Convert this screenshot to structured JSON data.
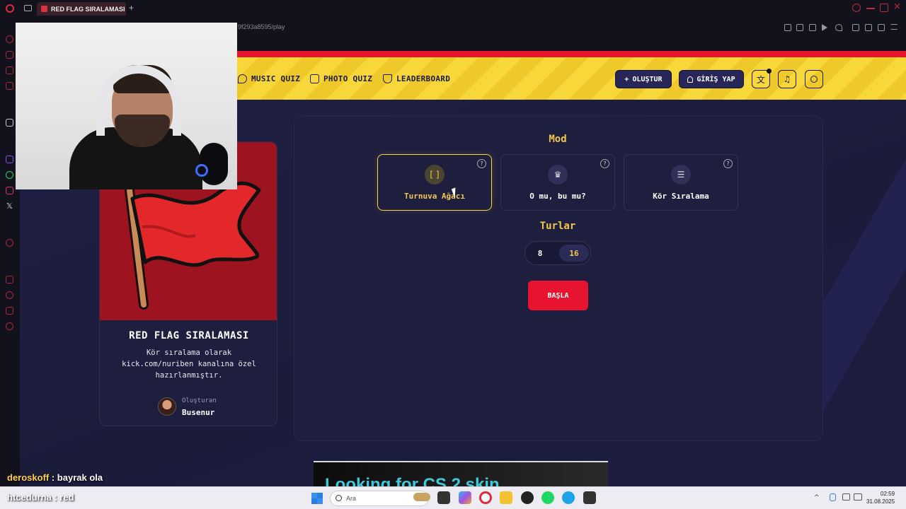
{
  "browser": {
    "tab_title": "RED FLAG SIRALAMASI - ",
    "new_tab": "+",
    "url_fragment": "9f293a8595/play"
  },
  "nav": {
    "links": [
      "MUSIC QUIZ",
      "PHOTO QUIZ",
      "LEADERBOARD"
    ],
    "create_label": "OLUŞTUR",
    "login_label": "GİRİŞ YAP"
  },
  "card": {
    "title": "RED FLAG SIRALAMASI",
    "description": "Kör sıralama olarak kick.com/nuriben kanalına özel hazırlanmıştır.",
    "creator_label": "Oluşturan",
    "creator_name": "Busenur"
  },
  "play": {
    "mode_title": "Mod",
    "modes": [
      {
        "label": "Turnuva Ağacı",
        "icon": "bracket-icon",
        "selected": true
      },
      {
        "label": "O mu, bu mu?",
        "icon": "crown-icon",
        "selected": false
      },
      {
        "label": "Kör Sıralama",
        "icon": "list-icon",
        "selected": false
      }
    ],
    "rounds_title": "Turlar",
    "rounds": [
      "8",
      "16"
    ],
    "selected_round": "16",
    "start_label": "BAŞLA"
  },
  "ad": {
    "text": "Looking for CS 2 skin"
  },
  "chat": [
    {
      "user": "deroskoff",
      "message": " : bayrak ola"
    },
    {
      "user": "htcedurna",
      "message": " : red"
    }
  ],
  "taskbar": {
    "search_placeholder": "Ara",
    "time": "02:59",
    "date": "31.08.2025"
  },
  "colors": {
    "accent_yellow": "#f7d73a",
    "brand_red": "#e8132e",
    "background_navy": "#1b1b38"
  }
}
